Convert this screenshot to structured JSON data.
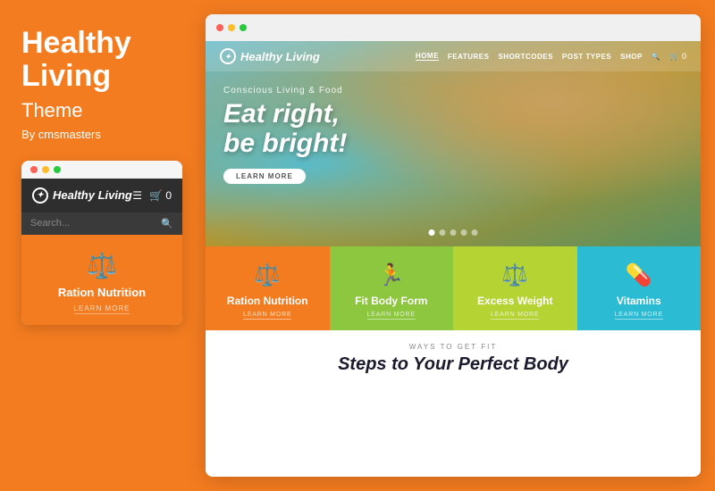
{
  "left": {
    "title": "Healthy Living",
    "subtitle": "Theme",
    "by": "By cmsmasters",
    "mobile": {
      "logo": "Healthy Living",
      "search_placeholder": "Search...",
      "feature": {
        "label": "Ration Nutrition",
        "learn_more": "LEARN MORE"
      }
    }
  },
  "browser": {
    "nav": {
      "logo": "Healthy Living",
      "links": [
        "HOME",
        "FEATURES",
        "SHORTCODES",
        "POST TYPES",
        "SHOP"
      ]
    },
    "hero": {
      "tagline": "Conscious Living & Food",
      "headline_line1": "Eat right,",
      "headline_line2": "be bright!",
      "cta_label": "LEARN MORE"
    },
    "features": [
      {
        "label": "Ration Nutrition",
        "learn": "LEARN MORE",
        "color_class": "fc-orange",
        "icon": "⚖"
      },
      {
        "label": "Fit Body Form",
        "learn": "LEARN MORE",
        "color_class": "fc-green",
        "icon": "🏃"
      },
      {
        "label": "Excess Weight",
        "learn": "LEARN MORE",
        "color_class": "fc-lime",
        "icon": "⚖"
      },
      {
        "label": "Vitamins",
        "learn": "LEARN MORE",
        "color_class": "fc-teal",
        "icon": "💊"
      }
    ],
    "bottom": {
      "ways_label": "WAYS TO GET FIT",
      "headline": "Steps to Your Perfect Body"
    }
  },
  "dots": [
    "active",
    "",
    "",
    "",
    ""
  ]
}
